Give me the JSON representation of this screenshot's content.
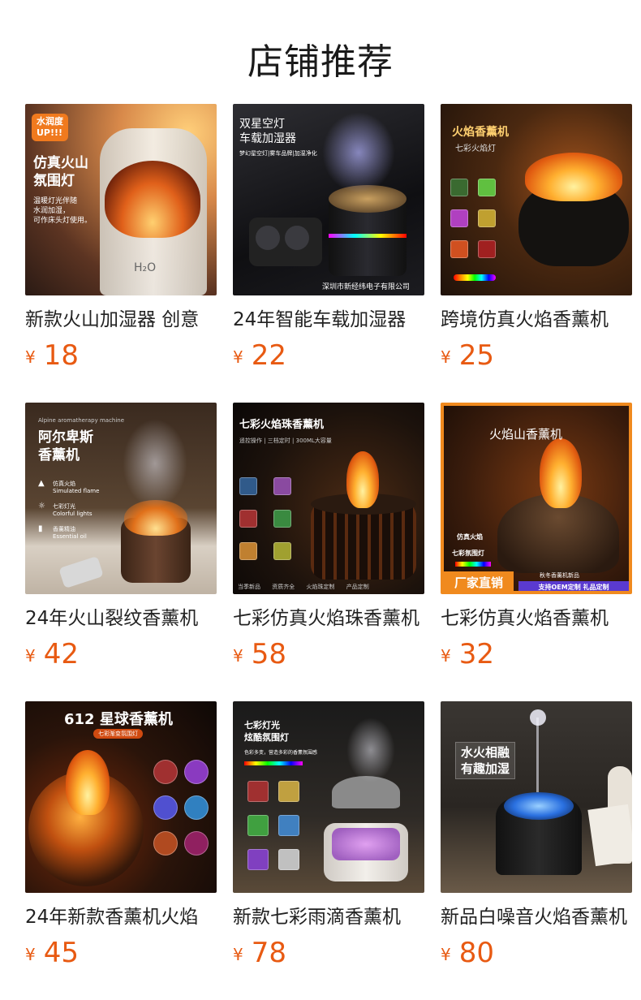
{
  "page_title": "店铺推荐",
  "products": [
    {
      "name": "新款火山加湿器 创意",
      "currency": "¥",
      "price": "18",
      "image_text": [
        "水润度",
        "UP!!!",
        "仿真火山",
        "氛围灯",
        "温暖灯光伴随",
        "水润加湿，",
        "可作床头灯使用。",
        "H₂O"
      ]
    },
    {
      "name": "24年智能车载加湿器",
      "currency": "¥",
      "price": "22",
      "image_text": [
        "双星空灯",
        "车载加湿器",
        "梦幻星空灯|雾车品牌|加湿净化",
        "深圳市新经纬电子有限公司"
      ]
    },
    {
      "name": "跨境仿真火焰香薰机",
      "currency": "¥",
      "price": "25",
      "image_text": [
        "火焰香薰机",
        "七彩火焰灯"
      ]
    },
    {
      "name": "24年火山裂纹香薰机",
      "currency": "¥",
      "price": "42",
      "image_text": [
        "Alpine aromatherapy machine",
        "阿尔卑斯",
        "香薰机",
        "仿真火焰",
        "Simulated flame",
        "七彩灯光",
        "Colorful lights",
        "香薰精油",
        "Essential oil"
      ]
    },
    {
      "name": "七彩仿真火焰珠香薰机",
      "currency": "¥",
      "price": "58",
      "image_text": [
        "七彩火焰珠香薰机",
        "遥控操作 | 三档定时 | 300ML大容量",
        "当季新品",
        "资质齐全",
        "火焰珠定制",
        "产品定制"
      ]
    },
    {
      "name": "七彩仿真火焰香薰机",
      "currency": "¥",
      "price": "32",
      "image_text": [
        "火焰山香薰机",
        "仿真火焰",
        "七彩氛围灯",
        "厂家直销",
        "秋冬香薰机新品",
        "支持OEM定制 礼品定制"
      ]
    },
    {
      "name": "24年新款香薰机火焰",
      "currency": "¥",
      "price": "45",
      "image_text": [
        "612 星球香薰机",
        "七彩渐变氛围灯"
      ]
    },
    {
      "name": "新款七彩雨滴香薰机",
      "currency": "¥",
      "price": "78",
      "image_text": [
        "七彩灯光",
        "炫酷氛围灯",
        "色彩多变，营造多彩的香薰氛围感"
      ]
    },
    {
      "name": "新品白噪音火焰香薰机",
      "currency": "¥",
      "price": "80",
      "image_text": [
        "水火相融",
        "有趣加湿"
      ]
    }
  ],
  "colors": {
    "price": "#e85a12",
    "title": "#1a1a1a",
    "name": "#222222",
    "badge_orange": "#f08a1e"
  }
}
